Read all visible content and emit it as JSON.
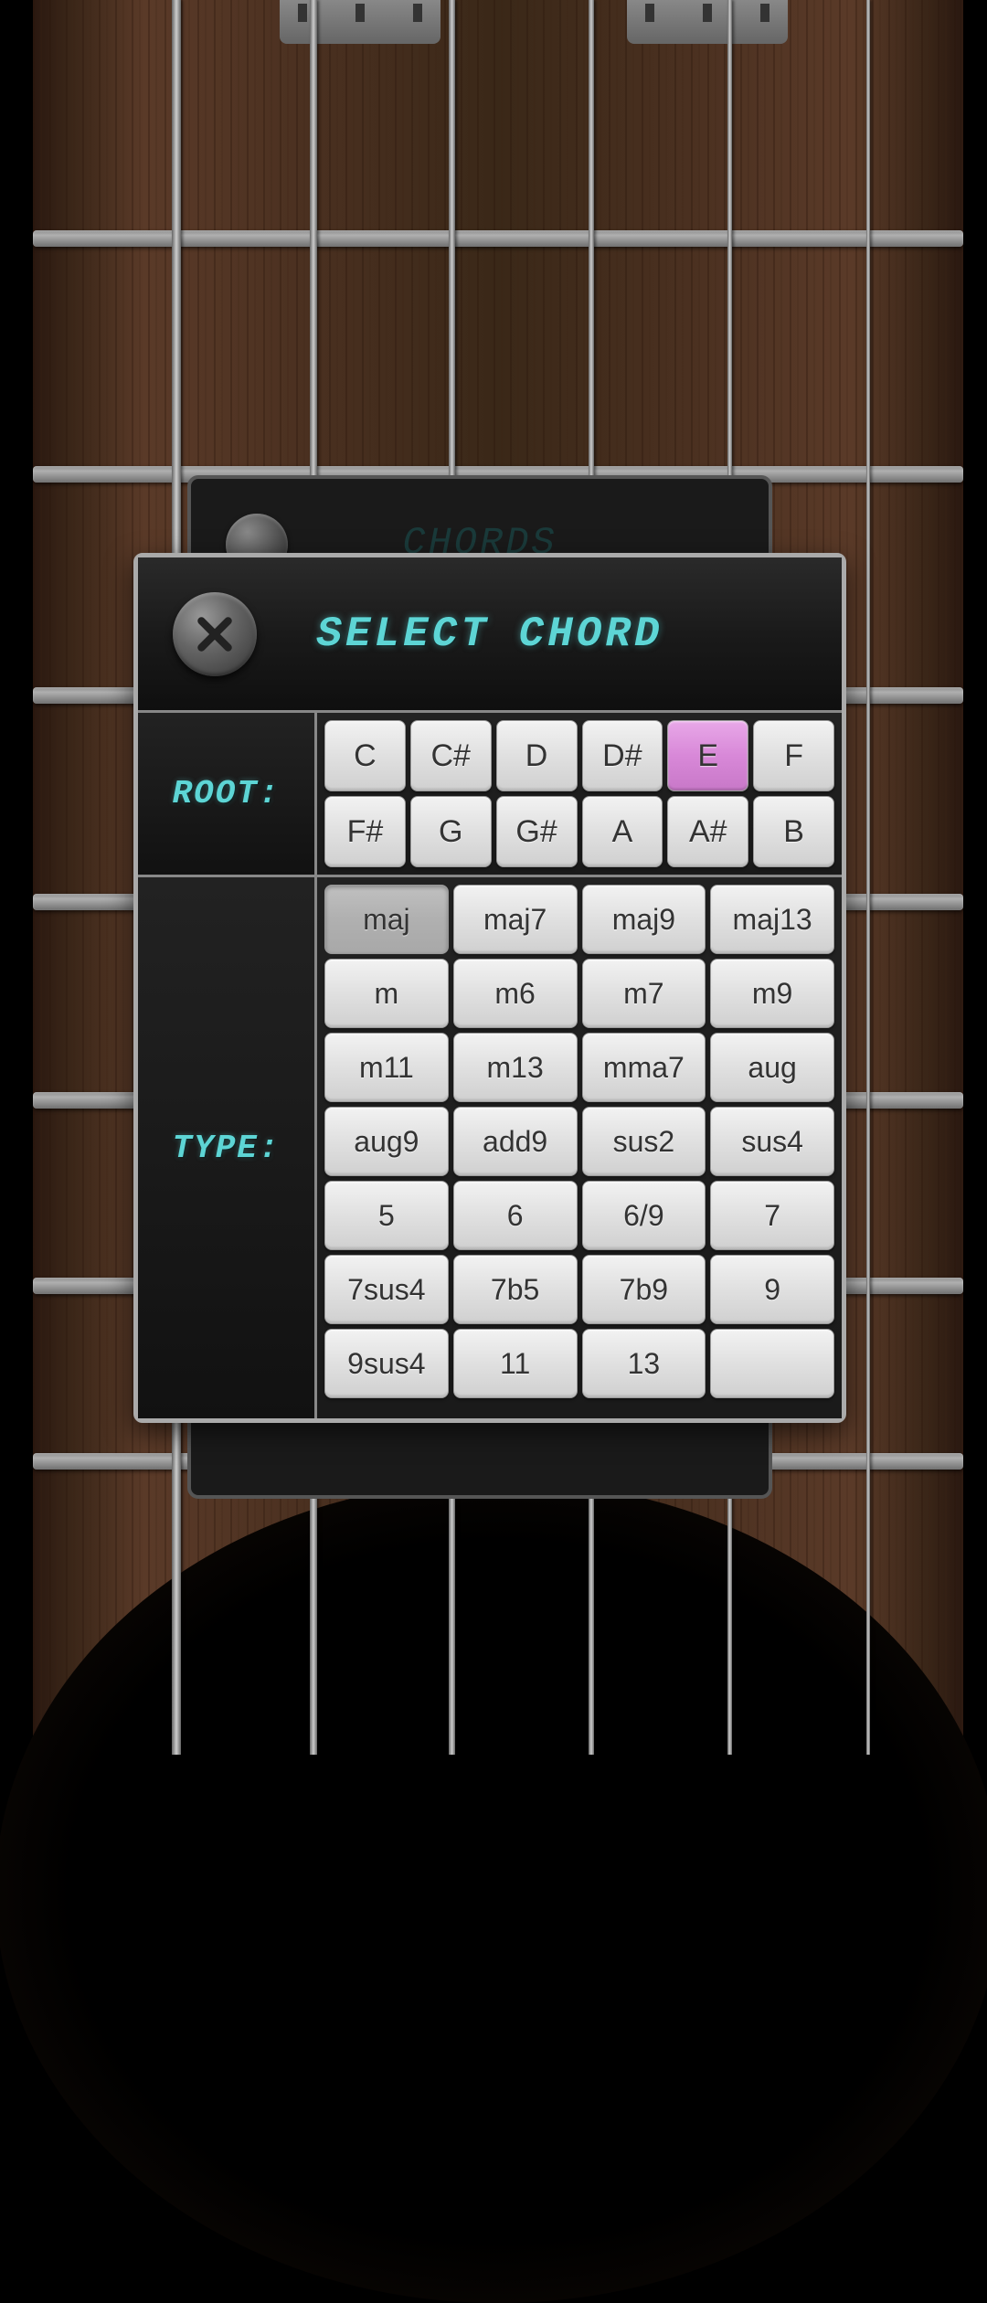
{
  "behind_dialog": {
    "title": "CHORDS"
  },
  "dialog": {
    "title": "SELECT CHORD",
    "root_label": "ROOT:",
    "type_label": "TYPE:",
    "roots": [
      "C",
      "C#",
      "D",
      "D#",
      "E",
      "F",
      "F#",
      "G",
      "G#",
      "A",
      "A#",
      "B"
    ],
    "selected_root": "E",
    "types": [
      "maj",
      "maj7",
      "maj9",
      "maj13",
      "m",
      "m6",
      "m7",
      "m9",
      "m11",
      "m13",
      "mma7",
      "aug",
      "aug9",
      "add9",
      "sus2",
      "sus4",
      "5",
      "6",
      "6/9",
      "7",
      "7sus4",
      "7b5",
      "7b9",
      "9",
      "9sus4",
      "11",
      "13",
      ""
    ],
    "pressed_type": "maj"
  }
}
